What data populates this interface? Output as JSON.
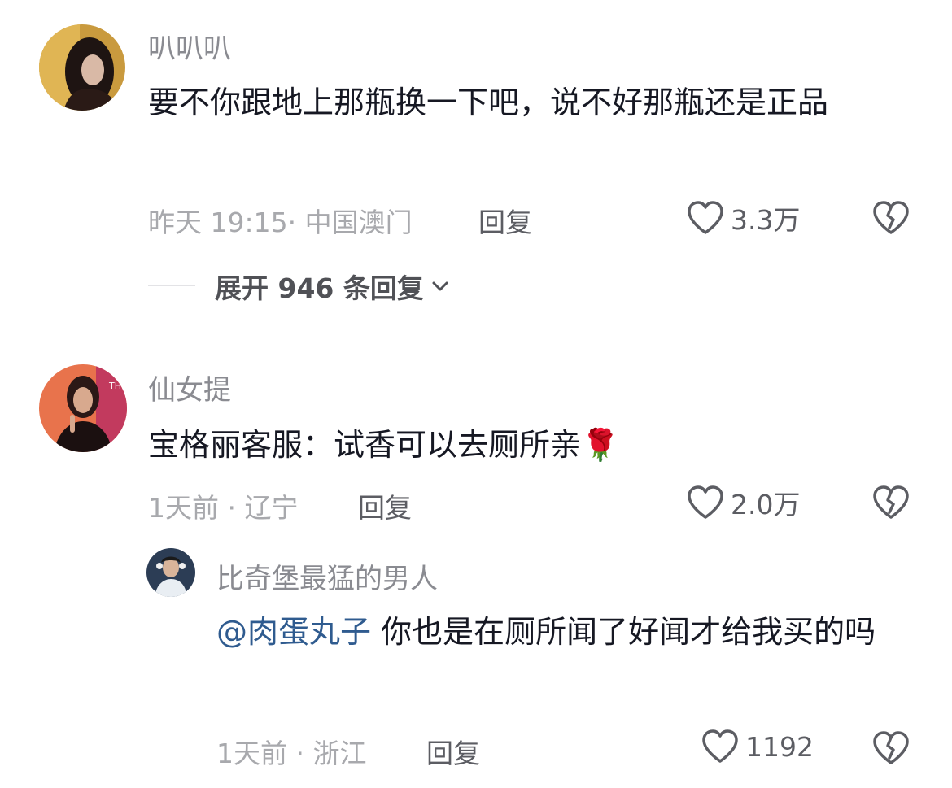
{
  "comments": [
    {
      "username": "叭叭叭",
      "text": "要不你跟地上那瓶换一下吧，说不好那瓶还是正品",
      "time_location": "昨天 19:15· 中国澳门",
      "reply_label": "回复",
      "likes": "3.3万",
      "expand_replies": "展开 946 条回复"
    },
    {
      "username": "仙女提",
      "text": "宝格丽客服：试香可以去厕所亲",
      "emoji": "🌹",
      "time_location": "1天前 · 辽宁",
      "reply_label": "回复",
      "likes": "2.0万",
      "replies": [
        {
          "username": "比奇堡最猛的男人",
          "mention": "@肉蛋丸子",
          "text": " 你也是在厕所闻了好闻才给我买的吗",
          "time_location": "1天前 · 浙江",
          "reply_label": "回复",
          "likes": "1192"
        }
      ]
    }
  ],
  "icons": {
    "like": "heart-outline-icon",
    "dislike": "broken-heart-icon",
    "expand": "chevron-down-icon"
  }
}
